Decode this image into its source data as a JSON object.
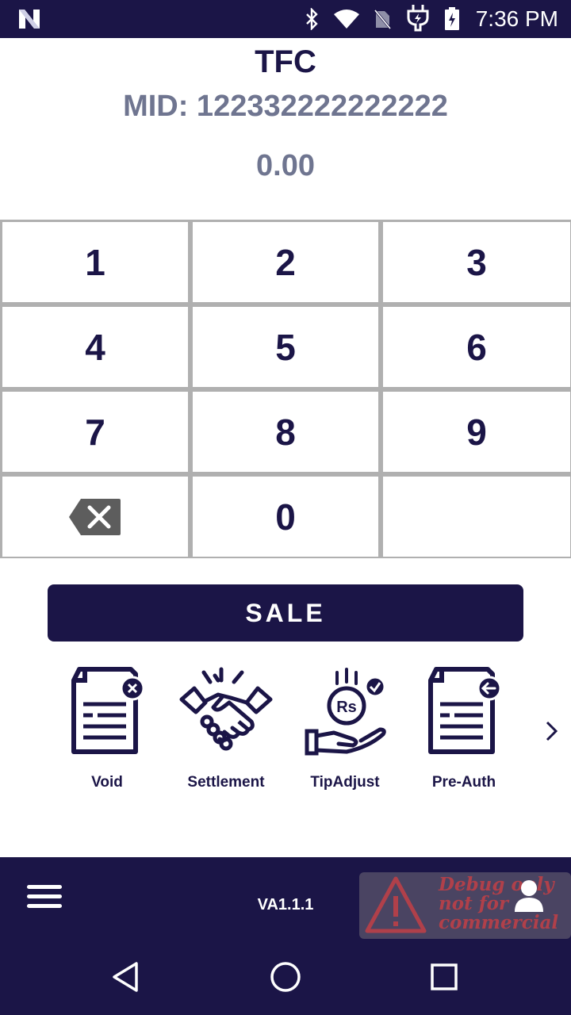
{
  "status_bar": {
    "time": "7:36 PM",
    "icons": [
      "notification-n-icon",
      "bluetooth-icon",
      "wifi-icon",
      "no-sim-icon",
      "charging-plug-icon",
      "battery-charging-icon"
    ]
  },
  "header": {
    "merchant_name": "TFC",
    "mid": "MID: 122332222222222",
    "amount": "0.00"
  },
  "keypad": {
    "keys": [
      "1",
      "2",
      "3",
      "4",
      "5",
      "6",
      "7",
      "8",
      "9",
      "",
      "0",
      ""
    ],
    "backspace_icon": "backspace-icon"
  },
  "sale_button": {
    "label": "SALE"
  },
  "actions": [
    {
      "label": "Void",
      "icon": "void-document-icon"
    },
    {
      "label": "Settlement",
      "icon": "handshake-icon"
    },
    {
      "label": "TipAdjust",
      "icon": "rupee-hand-icon"
    },
    {
      "label": "Pre-Auth",
      "icon": "preauth-document-icon"
    }
  ],
  "bottom_bar": {
    "version": "VA1.1.1",
    "debug_text_line1": "Debug only",
    "debug_text_line2": "not for",
    "debug_text_line3": "commercial"
  },
  "colors": {
    "brand": "#1b1547",
    "muted_text": "#6f7590",
    "keypad_grid": "#b0b0b0",
    "debug_badge": "#4a4462",
    "debug_text": "#b0404a"
  }
}
